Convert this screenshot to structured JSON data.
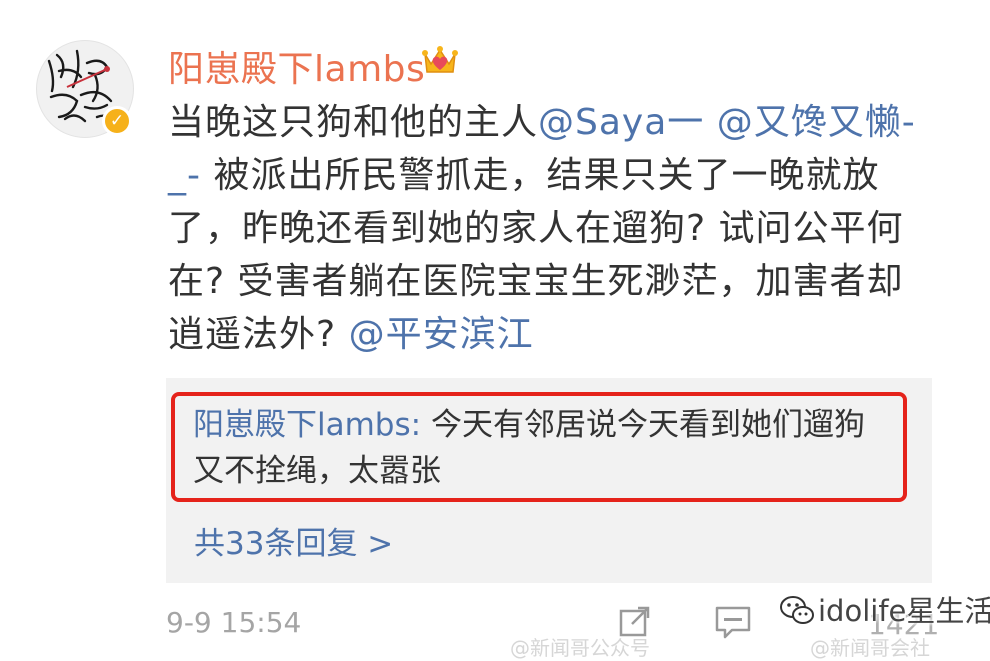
{
  "post": {
    "username": "阳崽殿下lambs",
    "avatar_text": "阳崽 就是我",
    "text_parts": [
      {
        "type": "text",
        "value": "当晚这只狗和他的主人"
      },
      {
        "type": "mention",
        "value": "@Saya一"
      },
      {
        "type": "text",
        "value": " "
      },
      {
        "type": "mention",
        "value": "@又馋又懒-_-"
      },
      {
        "type": "text",
        "value": " 被派出所民警抓走，结果只关了一晚就放了，昨晚还看到她的家人在遛狗? 试问公平何在? 受害者躺在医院宝宝生死渺茫，加害者却逍遥法外? "
      },
      {
        "type": "mention",
        "value": "@平安滨江"
      }
    ],
    "time": "9-9 15:54",
    "like_count": "1421"
  },
  "reply": {
    "username": "阳崽殿下lambs:",
    "text": " 今天有邻居说今天看到她们遛狗又不拴绳，太嚣张"
  },
  "reply_count_label": "共33条回复 >",
  "watermark": {
    "text": "idolife星生活",
    "faint_left": "@新闻哥公众号",
    "faint_right": "@新闻哥会社"
  },
  "colors": {
    "username": "#eb7350",
    "link": "#4e73ab",
    "highlight_border": "#e5231b",
    "verified_badge": "#f6b11a"
  },
  "icons": {
    "verified": "verified-badge-icon",
    "crown": "crown-heart-icon",
    "share": "share-icon",
    "comment": "comment-icon"
  }
}
